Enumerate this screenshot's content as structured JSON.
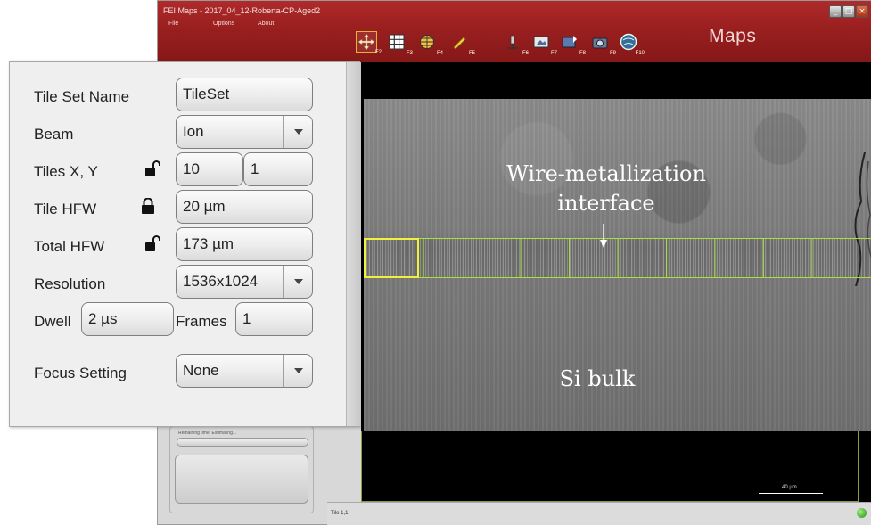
{
  "window": {
    "title": "FEI Maps - 2017_04_12-Roberta-CP-Aged2",
    "brand": "Maps",
    "menu": [
      "File",
      "Options",
      "About"
    ]
  },
  "toolbar": {
    "tools": [
      {
        "icon": "move-arrows-icon",
        "key": "F2",
        "selected": true
      },
      {
        "icon": "tile-grid-icon",
        "key": "F3"
      },
      {
        "icon": "globe-grid-icon",
        "key": "F4"
      },
      {
        "icon": "pencil-icon",
        "key": "F5"
      },
      {
        "icon": "microscope-icon",
        "key": "F6"
      },
      {
        "icon": "image-frame-icon",
        "key": "F7"
      },
      {
        "icon": "camera-flag-icon",
        "key": "F8"
      },
      {
        "icon": "camera-icon",
        "key": "F9"
      },
      {
        "icon": "globe-icon",
        "key": "F10"
      }
    ]
  },
  "settings": {
    "tile_set_name": {
      "label": "Tile Set Name",
      "value": "TileSet"
    },
    "beam": {
      "label": "Beam",
      "value": "Ion"
    },
    "tiles_xy": {
      "label": "Tiles X, Y",
      "x": "10",
      "y": "1",
      "locked": false
    },
    "tile_hfw": {
      "label": "Tile HFW",
      "value": "20 µm",
      "locked": true
    },
    "total_hfw": {
      "label": "Total HFW",
      "value": "173 µm",
      "locked": false
    },
    "resolution": {
      "label": "Resolution",
      "value": "1536x1024"
    },
    "dwell": {
      "label": "Dwell",
      "value": "2 µs"
    },
    "frames": {
      "label": "Frames",
      "value": "1"
    },
    "focus_setting": {
      "label": "Focus Setting",
      "value": "None"
    }
  },
  "image": {
    "annotation_line1": "Wire-metallization",
    "annotation_line2": "interface",
    "annotation_bulk": "Si bulk",
    "scale_label": "40 µm",
    "tile_count": 10,
    "colors": {
      "tile_outline": "#a8e040",
      "current_tile": "#f0f040"
    }
  },
  "progress": {
    "label": "Remaining time: Estimating...",
    "fraction": 0.0
  },
  "status": {
    "text": "Tile 1,1"
  },
  "colors": {
    "titlebar": "#9a1f1f",
    "panel_bg": "#efefef"
  }
}
